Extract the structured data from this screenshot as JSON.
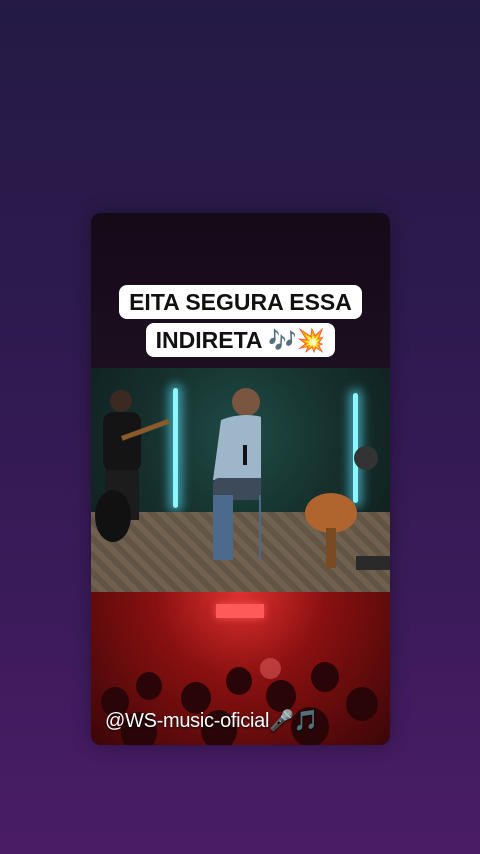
{
  "video": {
    "caption": "EITA SEGURA ESSA INDIRETA 🎶💥",
    "watermark": "@WS-music-oficial🎤🎵"
  }
}
